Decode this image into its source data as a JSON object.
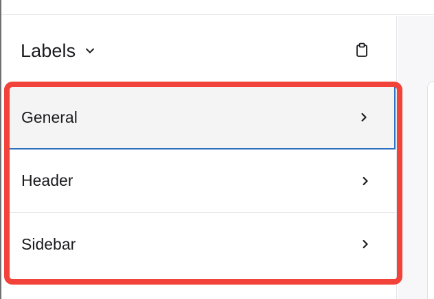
{
  "panel": {
    "title": "Labels",
    "title_icon": "chevron-down-icon",
    "action_icon": "clipboard-icon"
  },
  "list": {
    "items": [
      {
        "label": "General",
        "selected": true,
        "icon": "chevron-right-icon"
      },
      {
        "label": "Header",
        "selected": false,
        "icon": "chevron-right-icon"
      },
      {
        "label": "Sidebar",
        "selected": false,
        "icon": "chevron-right-icon"
      }
    ]
  },
  "colors": {
    "highlight": "#f1433a",
    "selected_background": "#f4f4f5",
    "selected_border": "#2f6fbf",
    "text": "#1b1b1f"
  }
}
